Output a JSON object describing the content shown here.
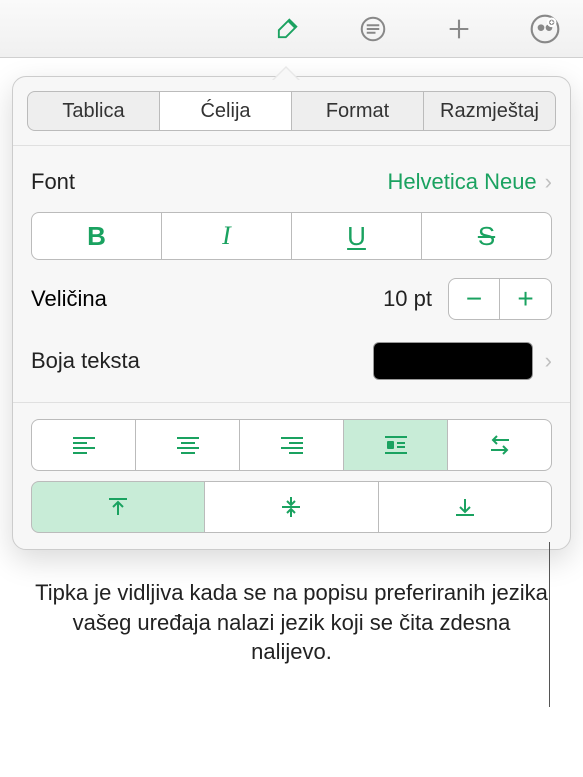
{
  "toolbar": {
    "icons": [
      "brush-icon",
      "format-icon",
      "add-icon",
      "share-icon"
    ]
  },
  "tabs": [
    {
      "label": "Tablica",
      "selected": false
    },
    {
      "label": "Ćelija",
      "selected": true
    },
    {
      "label": "Format",
      "selected": false
    },
    {
      "label": "Razmještaj",
      "selected": false
    }
  ],
  "font": {
    "label": "Font",
    "value": "Helvetica Neue"
  },
  "style": {
    "bold": "B",
    "italic": "I",
    "underline": "U",
    "strike": "S"
  },
  "size": {
    "label": "Veličina",
    "value": "10 pt"
  },
  "textColor": {
    "label": "Boja teksta",
    "value": "#000000"
  },
  "annotation": "Tipka je vidljiva kada se na popisu preferiranih jezika vašeg uređaja nalazi jezik koji se čita zdesna nalijevo.",
  "accent": "#1aa260"
}
